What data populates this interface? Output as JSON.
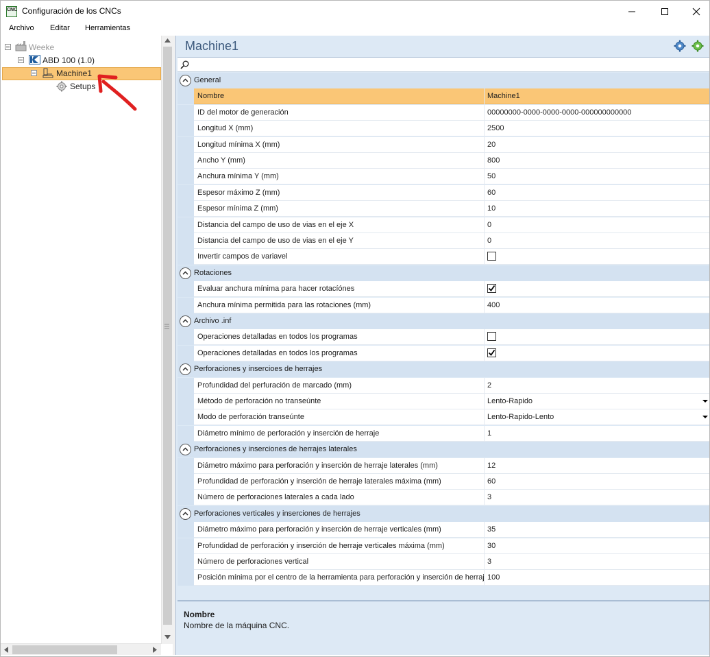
{
  "window": {
    "title": "Configuración de los CNCs",
    "app_icon_text": "CNC"
  },
  "menu": [
    "Archivo",
    "Editar",
    "Herramientas"
  ],
  "tree": {
    "root": "Weeke",
    "machine_group": "ABD 100 (1.0)",
    "machine": "Machine1",
    "setups": "Setups"
  },
  "panel": {
    "title": "Machine1",
    "search_value": ""
  },
  "categories": [
    {
      "label": "General",
      "rows": [
        {
          "name": "Nombre",
          "value": "Machine1",
          "selected": true
        },
        {
          "name": "ID del motor de generación",
          "value": "00000000-0000-0000-0000-000000000000"
        },
        {
          "name": "Longitud X (mm)",
          "value": "2500"
        },
        {
          "name": "Longitud mínima X (mm)",
          "value": "20"
        },
        {
          "name": "Ancho Y (mm)",
          "value": "800"
        },
        {
          "name": "Anchura mínima Y (mm)",
          "value": "50"
        },
        {
          "name": "Espesor máximo Z (mm)",
          "value": "60"
        },
        {
          "name": "Espesor mínima Z (mm)",
          "value": "10"
        },
        {
          "name": "Distancia del campo de uso de vias en el eje X",
          "value": "0"
        },
        {
          "name": "Distancia del campo de uso de vias en el eje Y",
          "value": "0"
        },
        {
          "name": "Invertir campos de variavel",
          "type": "checkbox",
          "checked": false
        }
      ]
    },
    {
      "label": "Rotaciones",
      "rows": [
        {
          "name": "Evaluar anchura mínima para hacer rotacíónes",
          "type": "checkbox",
          "checked": true
        },
        {
          "name": "Anchura mínima permitida para las rotaciones (mm)",
          "value": "400"
        }
      ]
    },
    {
      "label": "Archivo .inf",
      "rows": [
        {
          "name": "Operaciones detalladas en todos los programas",
          "type": "checkbox",
          "checked": false
        },
        {
          "name": "Operaciones detalladas en todos los programas",
          "type": "checkbox",
          "checked": true
        }
      ]
    },
    {
      "label": "Perforaciones y insercioes de herrajes",
      "rows": [
        {
          "name": "Profundidad del perfuración de marcado (mm)",
          "value": "2"
        },
        {
          "name": "Método de perforación no transeúnte",
          "value": "Lento-Rapido",
          "type": "dropdown"
        },
        {
          "name": "Modo de perforación transeúnte",
          "value": "Lento-Rapido-Lento",
          "type": "dropdown"
        },
        {
          "name": "Diámetro mínimo de perforación y inserción de herraje",
          "value": "1"
        }
      ]
    },
    {
      "label": "Perforaciones y inserciones de herrajes laterales",
      "rows": [
        {
          "name": "Diámetro máximo para perforación y inserción de herraje laterales (mm)",
          "value": "12"
        },
        {
          "name": "Profundidad de perforación y inserción de herraje laterales máxima (mm)",
          "value": "60"
        },
        {
          "name": "Número de perforaciones laterales a cada lado",
          "value": "3"
        }
      ]
    },
    {
      "label": "Perforaciones verticales y inserciones de herrajes",
      "rows": [
        {
          "name": "Diámetro máximo para perforación y inserción de herraje verticales (mm)",
          "value": "35"
        },
        {
          "name": "Profundidad de perforación y inserción de herraje verticales máxima (mm)",
          "value": "30"
        },
        {
          "name": "Número de perforaciones vertical",
          "value": "3"
        },
        {
          "name": "Posición mínima por el centro de la herramienta para perforación y inserción de herraje",
          "value": "100"
        }
      ]
    }
  ],
  "description": {
    "title": "Nombre",
    "text": "Nombre de la máquina CNC."
  },
  "colors": {
    "selection": "#fac676",
    "category_bg": "#d4e2f1",
    "panel_bg": "#dde9f5",
    "title_text": "#3d5a7d",
    "annotation_arrow": "#e02020"
  }
}
